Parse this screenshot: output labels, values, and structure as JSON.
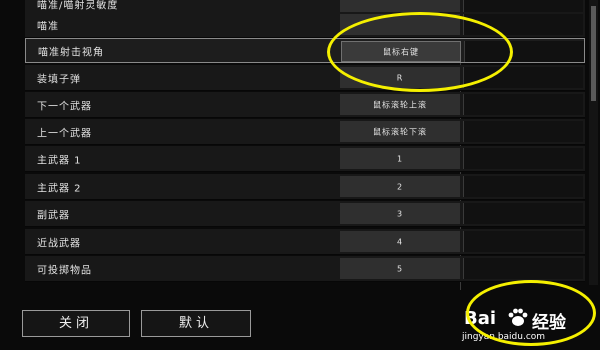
{
  "rows": [
    {
      "label": "喵准/喵射灵敏度",
      "key": "",
      "visible_key": true
    },
    {
      "label": "喵准",
      "key": "",
      "visible_key": true
    },
    {
      "label": "喵准射击视角",
      "key": "鼠标右键",
      "visible_key": true
    },
    {
      "label": "装填子弹",
      "key": "R",
      "visible_key": true
    },
    {
      "label": "下一个武器",
      "key": "鼠标滚轮上滚",
      "visible_key": true
    },
    {
      "label": "上一个武器",
      "key": "鼠标滚轮下滚",
      "visible_key": true
    },
    {
      "label": "主武器 1",
      "key": "1",
      "visible_key": true
    },
    {
      "label": "主武器 2",
      "key": "2",
      "visible_key": true
    },
    {
      "label": "副武器",
      "key": "3",
      "visible_key": true
    },
    {
      "label": "近战武器",
      "key": "4",
      "visible_key": true
    },
    {
      "label": "可投掷物品",
      "key": "5",
      "visible_key": true
    }
  ],
  "buttons": {
    "close": "关闭",
    "default": "默认"
  },
  "watermark": {
    "brand": "Bai",
    "tail": "经验",
    "url": "jingyan.baidu.com"
  },
  "colors": {
    "highlight": "#f5f000",
    "row_bg": "#181818",
    "key_bg": "#2f2f2f"
  }
}
